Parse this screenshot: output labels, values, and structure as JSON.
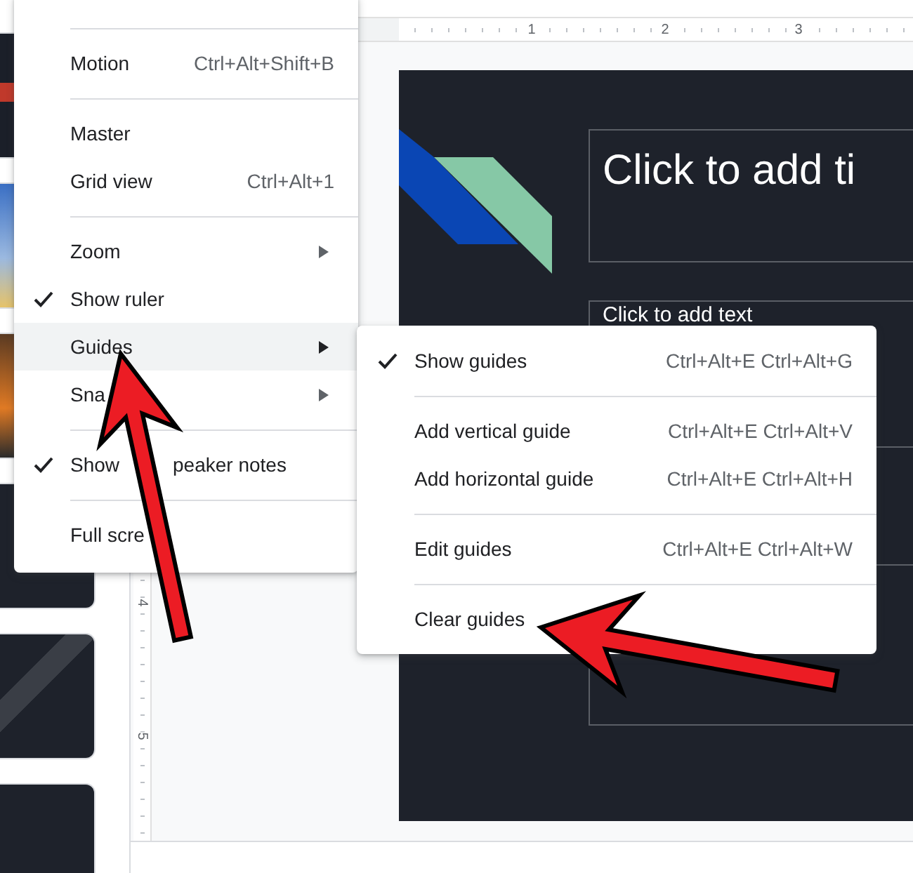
{
  "ruler": {
    "top_marks": [
      "1",
      "2",
      "3"
    ],
    "side_marks": [
      "4",
      "5"
    ]
  },
  "slide": {
    "title_placeholder": "Click to add ti",
    "body_placeholder": "Click to add text"
  },
  "view_menu": {
    "items": [
      {
        "kind": "separator"
      },
      {
        "kind": "item",
        "label": "Motion",
        "shortcut": "Ctrl+Alt+Shift+B",
        "checked": false,
        "selected": false,
        "submenu": false
      },
      {
        "kind": "separator"
      },
      {
        "kind": "item",
        "label": "Master",
        "checked": false,
        "selected": false,
        "submenu": false
      },
      {
        "kind": "item",
        "label": "Grid view",
        "shortcut": "Ctrl+Alt+1",
        "checked": false,
        "selected": false,
        "submenu": false
      },
      {
        "kind": "separator"
      },
      {
        "kind": "item",
        "label": "Zoom",
        "checked": false,
        "selected": false,
        "submenu": true
      },
      {
        "kind": "item",
        "label": "Show ruler",
        "checked": true,
        "selected": false,
        "submenu": false
      },
      {
        "kind": "item",
        "label": "Guides",
        "checked": false,
        "selected": true,
        "submenu": true
      },
      {
        "kind": "item",
        "label": "Sna",
        "checked": false,
        "selected": false,
        "submenu": true
      },
      {
        "kind": "separator"
      },
      {
        "kind": "item",
        "label": "Show",
        "label_after": "peaker notes",
        "checked": true,
        "selected": false,
        "submenu": false
      },
      {
        "kind": "separator"
      },
      {
        "kind": "item",
        "label": "Full scre",
        "checked": false,
        "selected": false,
        "submenu": false
      }
    ]
  },
  "guides_submenu": {
    "items": [
      {
        "kind": "item",
        "label": "Show guides",
        "shortcut": "Ctrl+Alt+E Ctrl+Alt+G",
        "checked": true,
        "selected": false,
        "submenu": false
      },
      {
        "kind": "separator"
      },
      {
        "kind": "item",
        "label": "Add vertical guide",
        "shortcut": "Ctrl+Alt+E Ctrl+Alt+V",
        "checked": false,
        "selected": false,
        "submenu": false
      },
      {
        "kind": "item",
        "label": "Add horizontal guide",
        "shortcut": "Ctrl+Alt+E Ctrl+Alt+H",
        "checked": false,
        "selected": false,
        "submenu": false
      },
      {
        "kind": "separator"
      },
      {
        "kind": "item",
        "label": "Edit guides",
        "shortcut": "Ctrl+Alt+E Ctrl+Alt+W",
        "checked": false,
        "selected": false,
        "submenu": false
      },
      {
        "kind": "separator"
      },
      {
        "kind": "item",
        "label": "Clear guides",
        "checked": false,
        "selected": false,
        "submenu": false
      }
    ]
  }
}
